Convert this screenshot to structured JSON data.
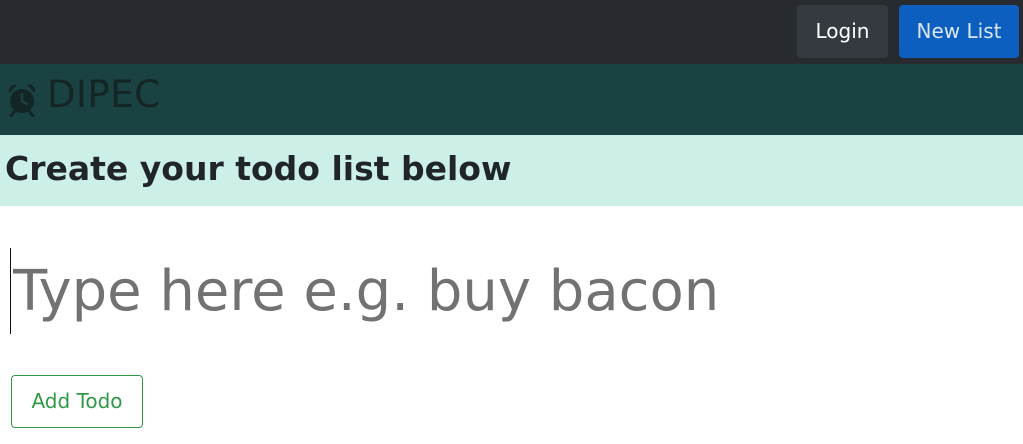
{
  "navbar": {
    "login_label": "Login",
    "new_list_label": "New List"
  },
  "brand": {
    "name": "DIPEC",
    "icon": "alarm-clock-icon"
  },
  "main": {
    "heading": "Create your todo list below",
    "todo_input": {
      "placeholder": "Type here e.g. buy bacon",
      "value": ""
    },
    "add_button_label": "Add Todo"
  },
  "colors": {
    "topbar": "#272a2e",
    "brandbar": "#1b4242",
    "heading_band": "#ccefe8",
    "primary": "#0d5fbf",
    "success": "#2f9a46"
  }
}
